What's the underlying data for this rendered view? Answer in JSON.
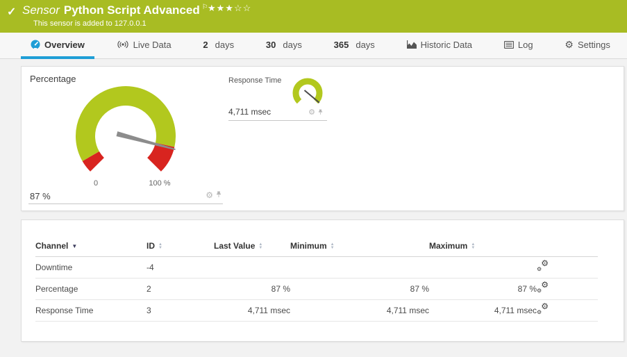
{
  "colors": {
    "banner_bg": "#a8bc23",
    "gauge_green": "#b2c81e",
    "gauge_red": "#d8241f",
    "accent_blue": "#1f9ed6",
    "needle_gray": "#8c8c8c"
  },
  "banner": {
    "check": "✓",
    "kind": "Sensor",
    "title": "Python Script Advanced",
    "flag": "⚐",
    "stars_filled": "★★★",
    "stars_empty": "☆☆",
    "subtitle": "This sensor is added to 127.0.0.1"
  },
  "tabs": [
    {
      "label": "Overview"
    },
    {
      "label": "Live Data"
    },
    {
      "num": "2",
      "label": "days"
    },
    {
      "num": "30",
      "label": "days"
    },
    {
      "num": "365",
      "label": "days"
    },
    {
      "label": "Historic Data"
    },
    {
      "label": "Log"
    },
    {
      "label": "Settings"
    }
  ],
  "gauges": {
    "percentage": {
      "title": "Percentage",
      "value_label": "87 %",
      "min_label": "0",
      "max_label": "100 %"
    },
    "response_time": {
      "title": "Response Time",
      "value_label": "4,711 msec"
    }
  },
  "chart_data": [
    {
      "type": "gauge",
      "title": "Percentage",
      "value": 87,
      "min": 0,
      "max": 100,
      "unit": "%",
      "red_zones": [
        [
          0,
          5
        ],
        [
          88,
          100
        ]
      ],
      "needle_at": 87
    },
    {
      "type": "gauge",
      "title": "Response Time",
      "value": 4711,
      "unit": "msec"
    }
  ],
  "table": {
    "headers": [
      "Channel",
      "ID",
      "Last Value",
      "Minimum",
      "Maximum"
    ],
    "rows": [
      {
        "channel": "Downtime",
        "id": "-4",
        "last": "",
        "min": "",
        "max": ""
      },
      {
        "channel": "Percentage",
        "id": "2",
        "last": "87 %",
        "min": "87 %",
        "max": "87 %"
      },
      {
        "channel": "Response Time",
        "id": "3",
        "last": "4,711 msec",
        "min": "4,711 msec",
        "max": "4,711 msec"
      }
    ]
  }
}
